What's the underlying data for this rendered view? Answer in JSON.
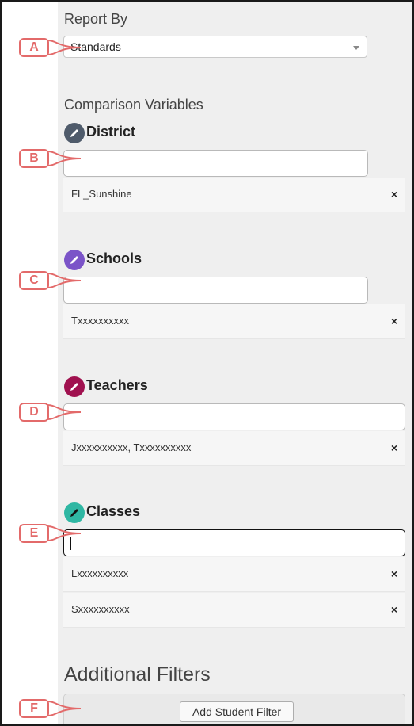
{
  "report_by": {
    "title": "Report By",
    "selected": "Standards"
  },
  "comparison": {
    "title": "Comparison Variables",
    "district": {
      "label": "District",
      "icon_color": "#4f5b6b",
      "value": "",
      "chips": [
        "FL_Sunshine"
      ]
    },
    "schools": {
      "label": "Schools",
      "icon_color": "#7b54c8",
      "value": "",
      "chips": [
        "Txxxxxxxxxx"
      ]
    },
    "teachers": {
      "label": "Teachers",
      "icon_color": "#a0114f",
      "value": "",
      "chips": [
        "Jxxxxxxxxxx, Txxxxxxxxxx"
      ]
    },
    "classes": {
      "label": "Classes",
      "icon_color": "#2fb7a3",
      "value": "",
      "chips": [
        "Lxxxxxxxxxx",
        "Sxxxxxxxxxx"
      ]
    }
  },
  "chip_remove_glyph": "×",
  "additional_filters": {
    "title": "Additional Filters",
    "button_label": "Add Student Filter"
  },
  "callouts": [
    "A",
    "B",
    "C",
    "D",
    "E",
    "F"
  ],
  "accent_colors": {
    "callout": "#e36a6a"
  }
}
